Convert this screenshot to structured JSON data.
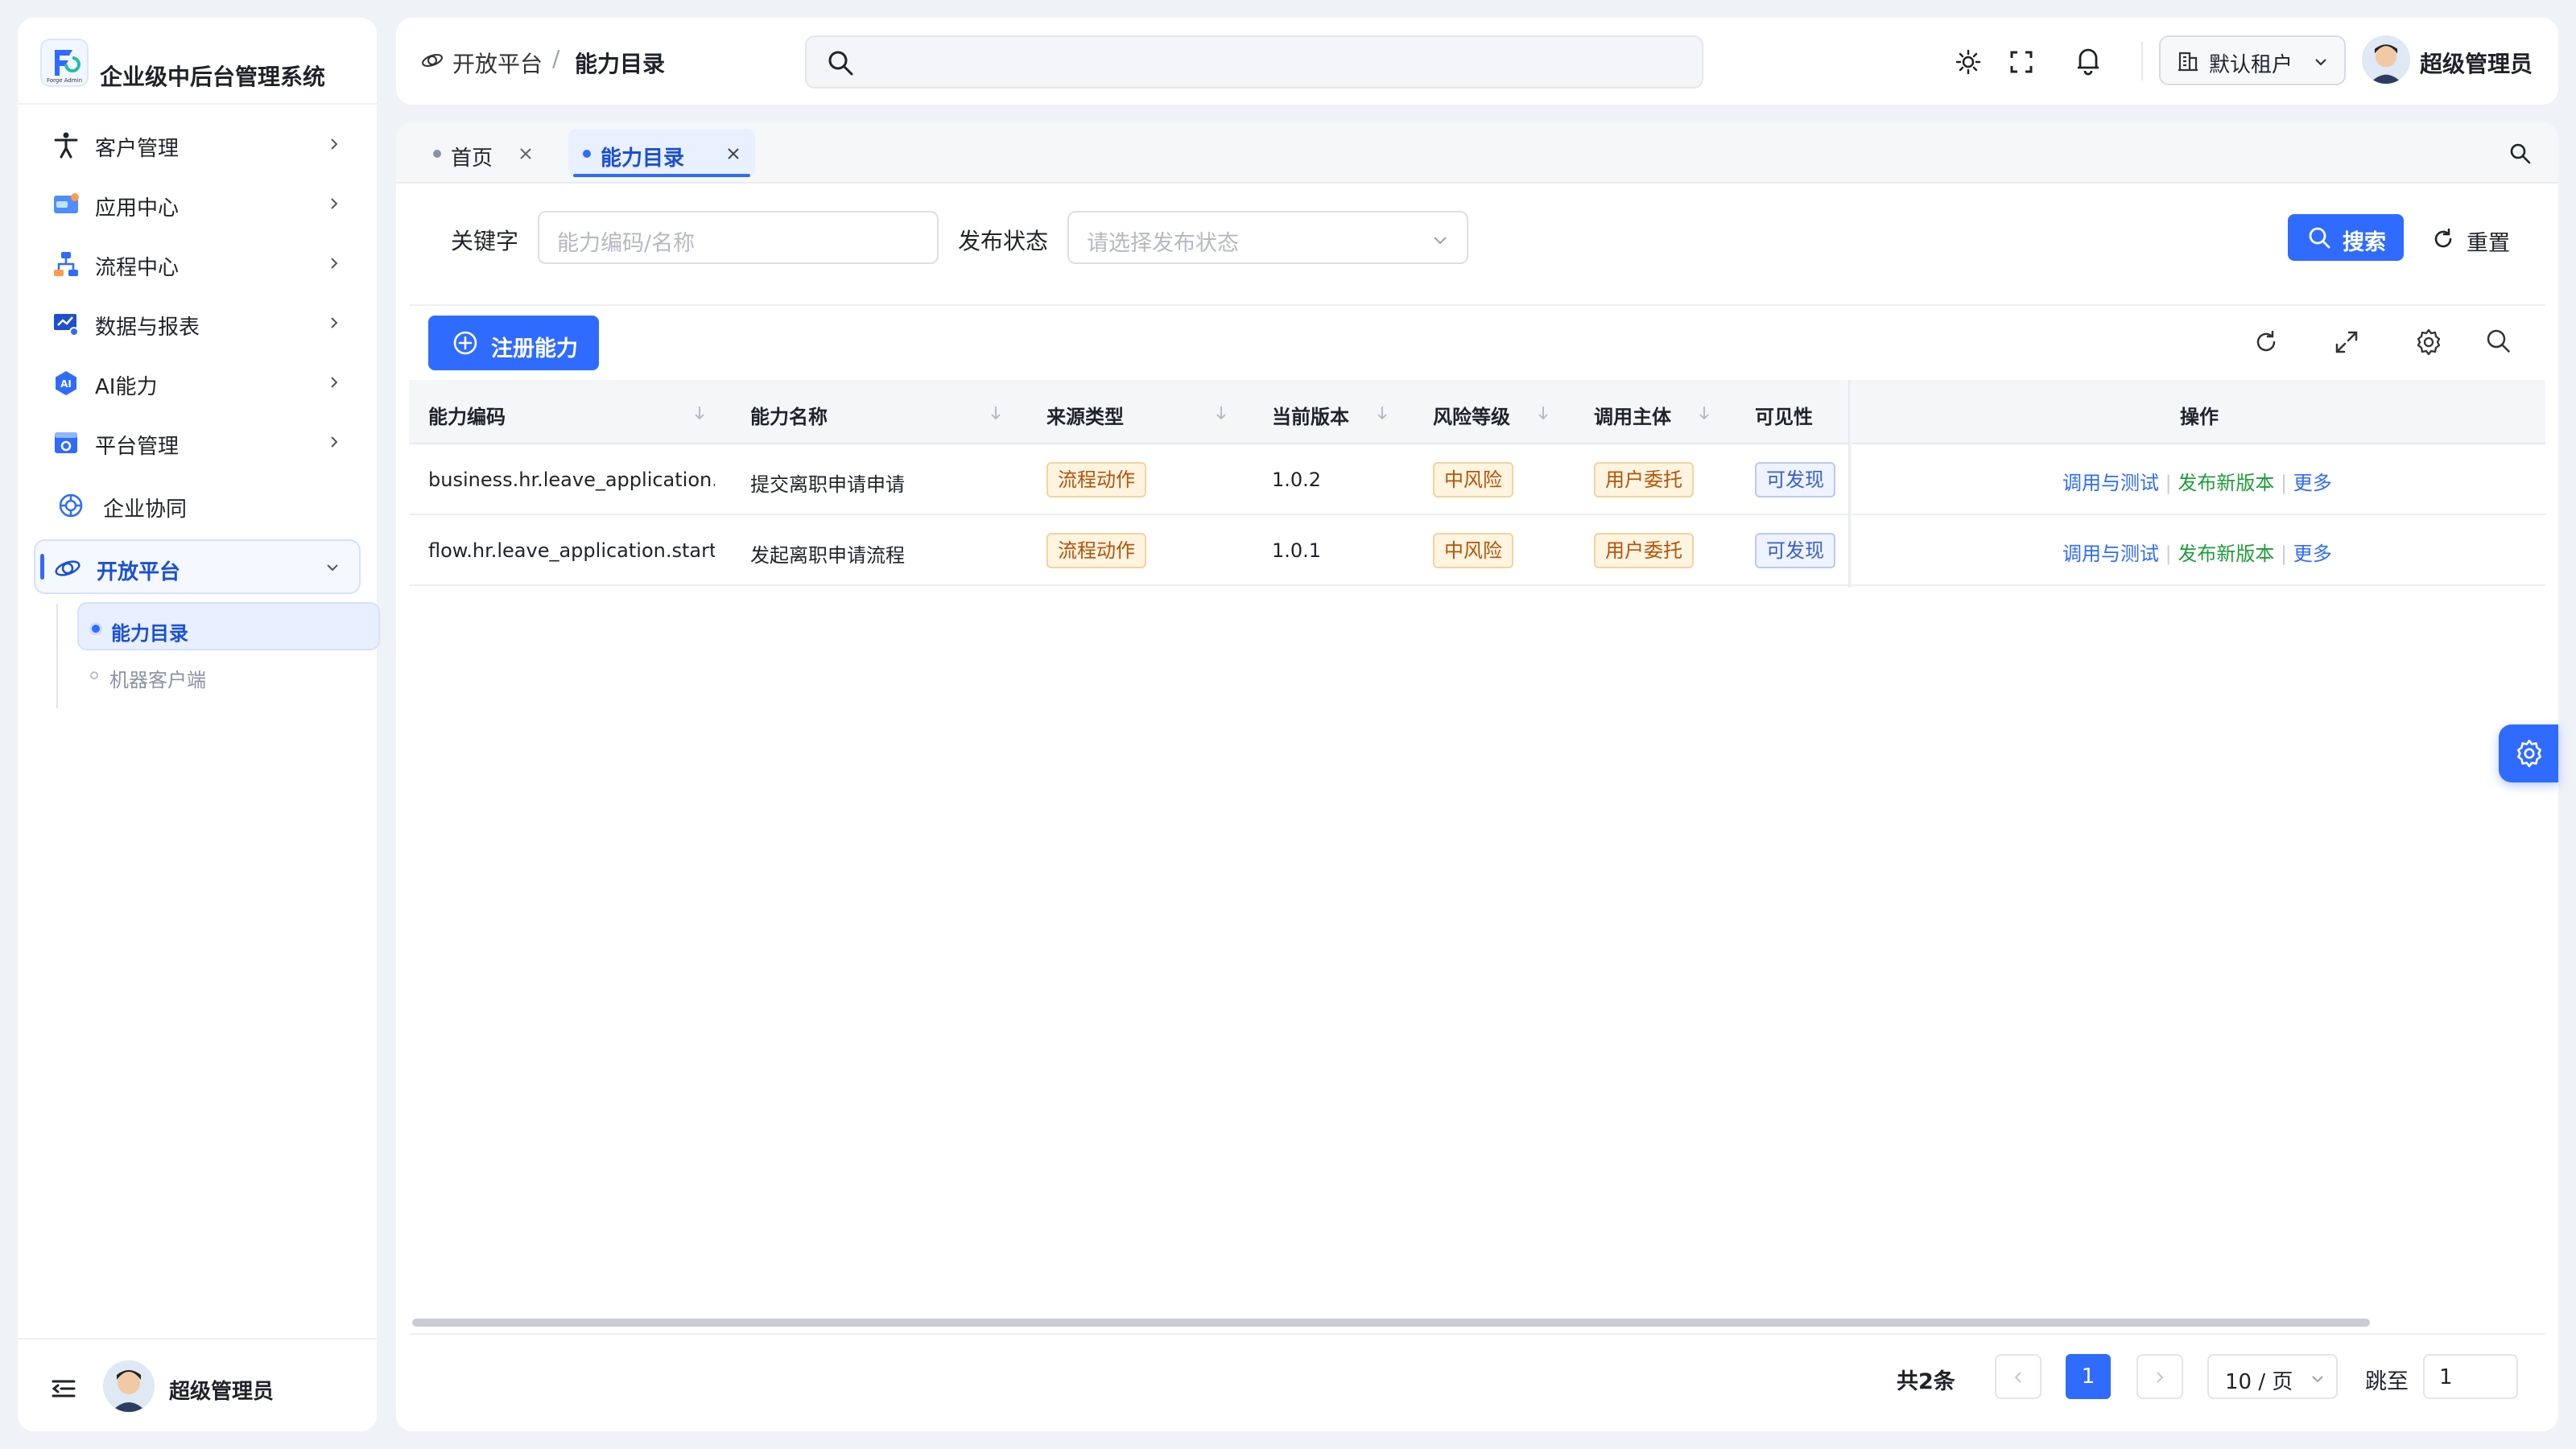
{
  "app": {
    "title": "企业级中后台管理系统",
    "logo_text": "Forge Admin"
  },
  "sidebar": {
    "items": [
      {
        "label": "客户管理",
        "icon": "accessibility-icon"
      },
      {
        "label": "应用中心",
        "icon": "app-center-icon"
      },
      {
        "label": "流程中心",
        "icon": "flow-icon"
      },
      {
        "label": "数据与报表",
        "icon": "report-icon"
      },
      {
        "label": "AI能力",
        "icon": "ai-icon"
      },
      {
        "label": "平台管理",
        "icon": "platform-icon"
      },
      {
        "label": "企业协同",
        "icon": "collaboration-icon"
      },
      {
        "label": "开放平台",
        "icon": "open-platform-icon",
        "expanded": true
      }
    ],
    "subitems": [
      {
        "label": "能力目录",
        "active": true
      },
      {
        "label": "机器客户端",
        "active": false
      }
    ],
    "user_name": "超级管理员"
  },
  "header": {
    "breadcrumb": [
      "开放平台",
      "能力目录"
    ],
    "breadcrumb_sep": "/",
    "tenant": "默认租户",
    "user_name": "超级管理员"
  },
  "tabs": [
    {
      "label": "首页",
      "active": false
    },
    {
      "label": "能力目录",
      "active": true
    }
  ],
  "filters": {
    "keyword_label": "关键字",
    "keyword_placeholder": "能力编码/名称",
    "status_label": "发布状态",
    "status_placeholder": "请选择发布状态",
    "search_label": "搜索",
    "reset_label": "重置"
  },
  "toolbar": {
    "register_label": "注册能力"
  },
  "table": {
    "columns": [
      "能力编码",
      "能力名称",
      "来源类型",
      "当前版本",
      "风险等级",
      "调用主体",
      "可见性",
      "操作"
    ],
    "rows": [
      {
        "code": "business.hr.leave_application.su",
        "name": "提交离职申请申请",
        "source": "流程动作",
        "version": "1.0.2",
        "risk": "中风险",
        "subject": "用户委托",
        "visibility": "可发现"
      },
      {
        "code": "flow.hr.leave_application.start",
        "name": "发起离职申请流程",
        "source": "流程动作",
        "version": "1.0.1",
        "risk": "中风险",
        "subject": "用户委托",
        "visibility": "可发现"
      }
    ],
    "actions": {
      "test": "调用与测试",
      "publish": "发布新版本",
      "more": "更多",
      "sep": "|"
    }
  },
  "pagination": {
    "total": "共2条",
    "current_page": "1",
    "page_size": "10 / 页",
    "jump_label": "跳至",
    "jump_value": "1"
  },
  "colors": {
    "primary": "#2f6bff",
    "publish_green": "#1f9d3a",
    "tag_orange": "#b45309",
    "tag_blue": "#3a5fcf"
  }
}
